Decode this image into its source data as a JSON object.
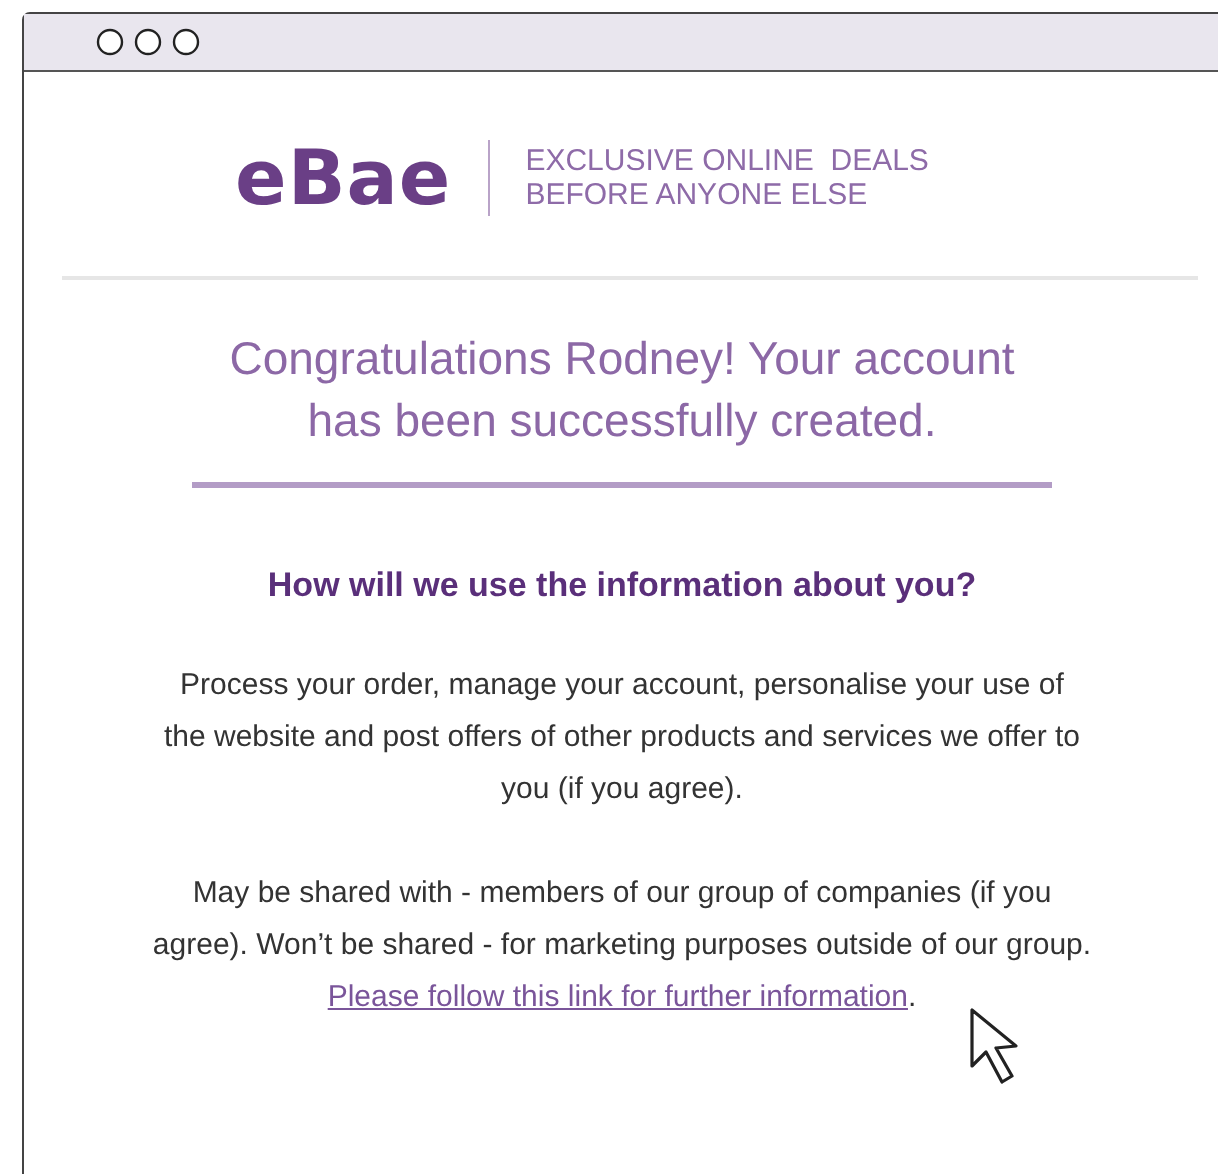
{
  "logo": {
    "brand": "eBae",
    "tagline_lines": [
      "EXCLUSIVE ONLINE  DEALS",
      "BEFORE ANYONE ELSE"
    ]
  },
  "heading_lines": [
    "Congratulations Rodney! Your account",
    "has been successfully created."
  ],
  "subheading": "How will we use the information about you?",
  "paragraph_1": "Process your order, manage your account, personalise your use of the website and post offers of other products and services we offer to you (if you agree).",
  "paragraph_2": {
    "text": "May be shared with - members of our group of companies (if you agree). Won’t be shared - for marketing purposes outside of our group.",
    "link": "Please follow this link for further information",
    "after_link": "."
  }
}
